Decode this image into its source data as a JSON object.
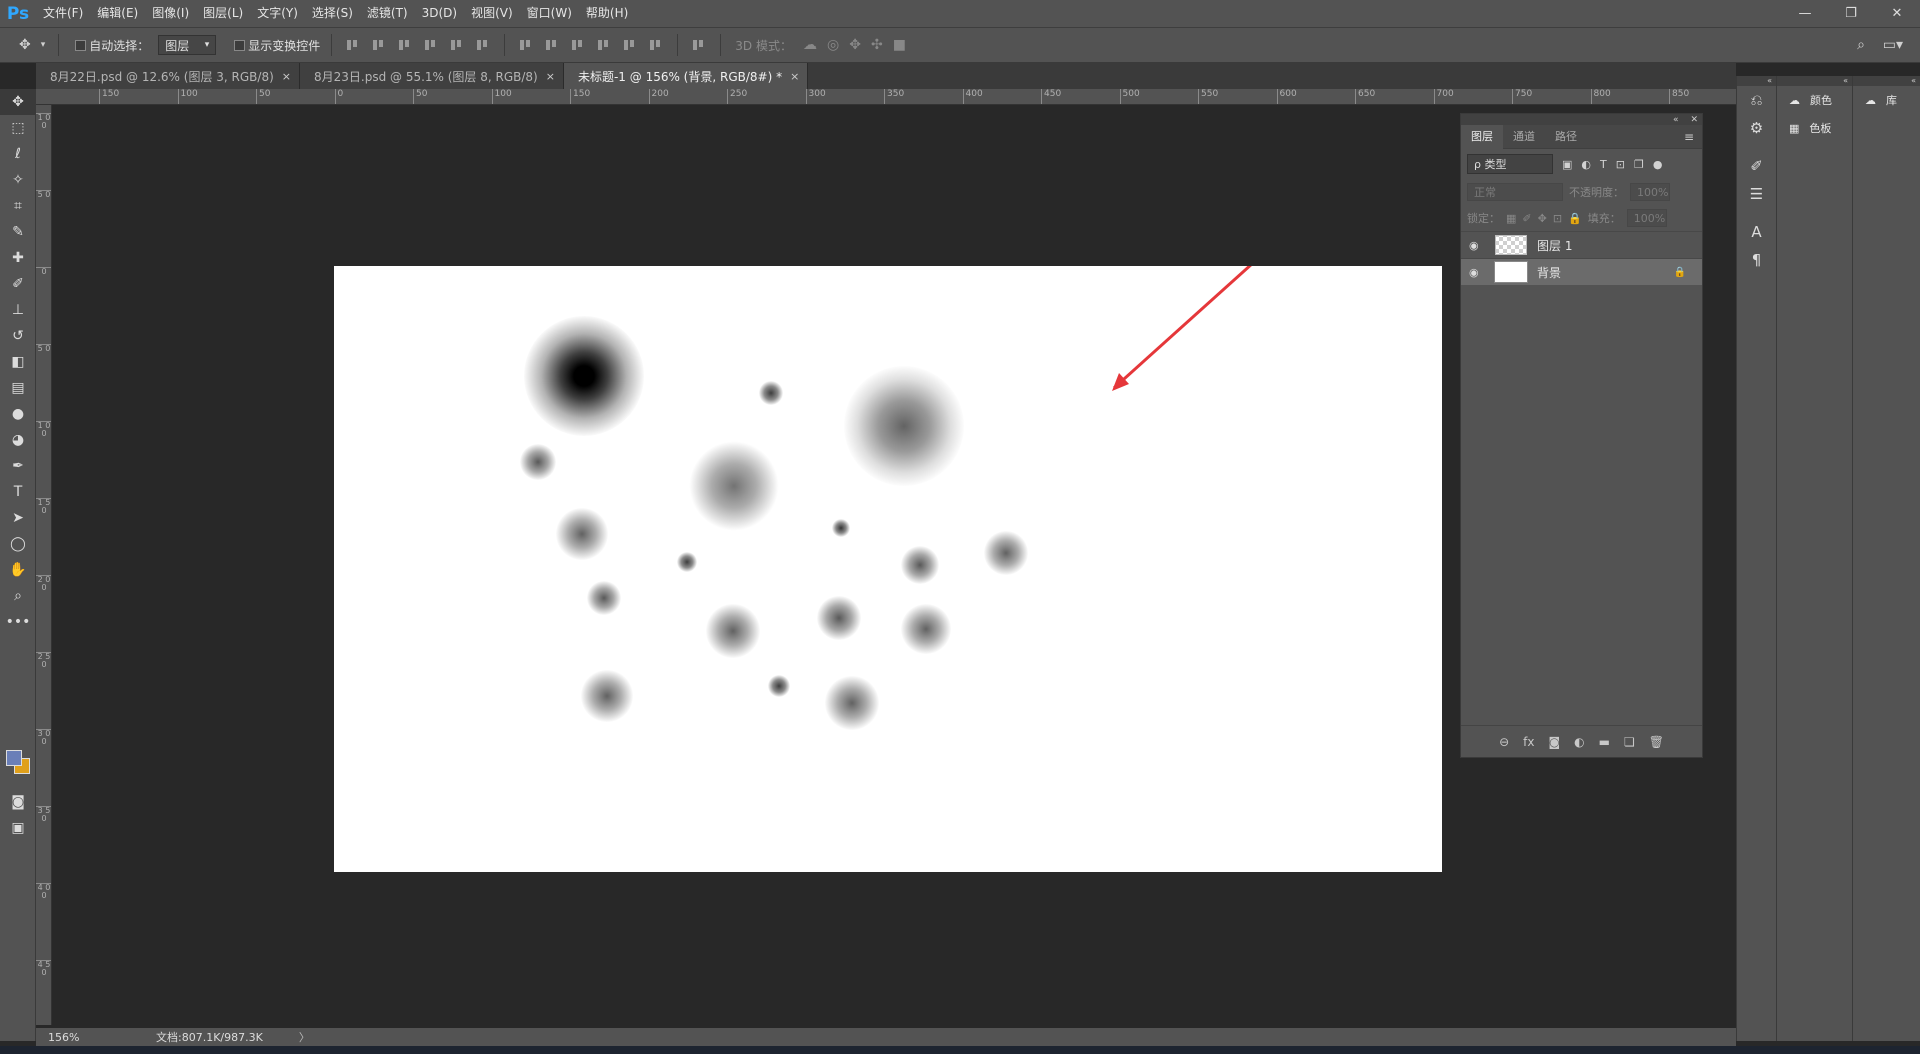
{
  "app": {
    "logo": "Ps",
    "menu": [
      "文件(F)",
      "编辑(E)",
      "图像(I)",
      "图层(L)",
      "文字(Y)",
      "选择(S)",
      "滤镜(T)",
      "3D(D)",
      "视图(V)",
      "窗口(W)",
      "帮助(H)"
    ],
    "window_controls": [
      "—",
      "❐",
      "✕"
    ]
  },
  "options": {
    "auto_select_label": "自动选择：",
    "auto_select_value": "图层",
    "show_transform_label": "显示变换控件",
    "mode_3d_label": "3D 模式："
  },
  "tabs": [
    {
      "label": "8月22日.psd @ 12.6% (图层 3, RGB/8)",
      "close": "×"
    },
    {
      "label": "8月23日.psd @ 55.1% (图层 8, RGB/8)",
      "close": "×"
    },
    {
      "label": "未标题-1 @ 156% (背景, RGB/8#) *",
      "close": "×"
    }
  ],
  "ruler_top": [
    "150",
    "100",
    "50",
    "0",
    "50",
    "100",
    "150",
    "200",
    "250",
    "300",
    "350",
    "400",
    "450",
    "500",
    "550",
    "600",
    "650",
    "700",
    "750",
    "800",
    "850"
  ],
  "ruler_left": [
    "1 0 0",
    "5 0",
    "0",
    "5 0",
    "1 0 0",
    "1 5 0",
    "2 0 0",
    "2 5 0",
    "3 0 0",
    "3 5 0",
    "4 0 0",
    "4 5 0"
  ],
  "status": {
    "zoom": "156%",
    "doc_info": "文档:807.1K/987.3K",
    "arrow": "〉"
  },
  "layers_panel": {
    "header_icons": [
      "«",
      "✕"
    ],
    "tabs": [
      "图层",
      "通道",
      "路径"
    ],
    "menu_icon": "≡",
    "kind_filter": "ρ 类型",
    "blend_mode": "正常",
    "opacity_label": "不透明度：",
    "opacity_value": "100%",
    "lock_label": "锁定：",
    "fill_label": "填充：",
    "fill_value": "100%",
    "layers": [
      {
        "name": "图层 1",
        "visible": true,
        "locked": false
      },
      {
        "name": "背景",
        "visible": true,
        "locked": true
      }
    ],
    "footer_icons": [
      "⊖",
      "fx",
      "◙",
      "◐",
      "▬",
      "❏",
      "🗑"
    ]
  },
  "right_dock": {
    "color_label": "颜色",
    "swatches_label": "色板",
    "library_label": "库"
  },
  "colors": {
    "foreground": "#6a7fb8",
    "background": "#e0a01b",
    "accent_arrow": "#e5373a"
  }
}
